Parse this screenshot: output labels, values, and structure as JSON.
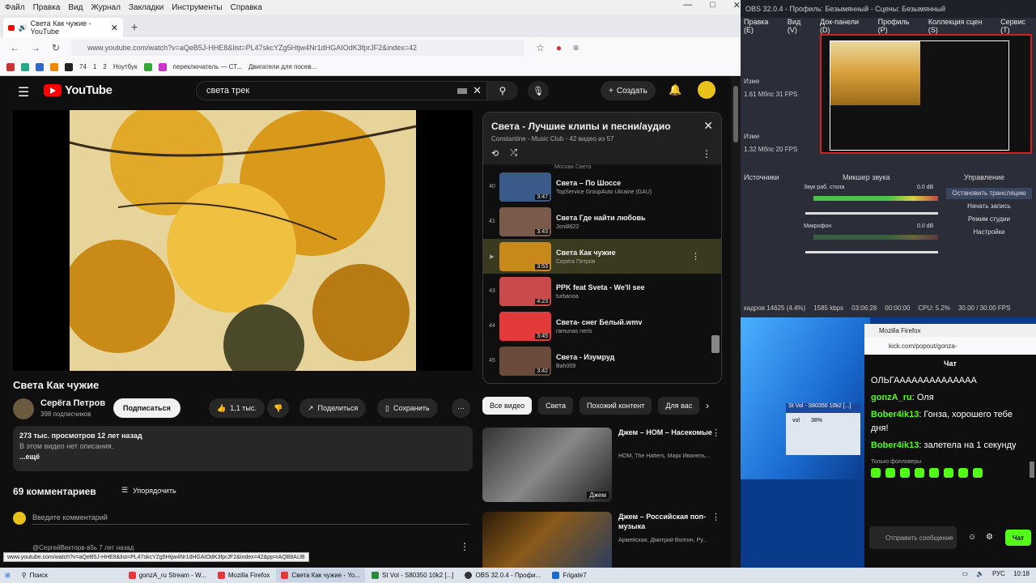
{
  "firefox": {
    "menu": [
      "Файл",
      "Правка",
      "Вид",
      "Журнал",
      "Закладки",
      "Инструменты",
      "Справка"
    ],
    "tab_title": "Света Как чужие - YouTube",
    "url": "www.youtube.com/watch?v=aQeB5J-HHE8&list=PL47skcYZg5Htjw4Nr1dHGAIOdK3fprJF2&index=42",
    "bookmarks": [
      "74",
      "1",
      "2",
      "Ноутбук",
      "переключатель — СТ...",
      "Двигатели для посев..."
    ],
    "status_url": "www.youtube.com/watch?v=aQeB5J-HHE8&list=PL47skcYZg5Htjw4Nr1dHGAIOdK3fprJF2&index=42&pp=iAQB8AUB"
  },
  "youtube": {
    "logo": "YouTube",
    "search_query": "света трек",
    "create_label": "Создать",
    "video": {
      "title": "Света Как чужие",
      "channel": "Серёга Петров",
      "subscribers": "398 подписчиков",
      "subscribe_label": "Подписаться",
      "likes": "1,1 тыс.",
      "share_label": "Поделиться",
      "save_label": "Сохранить",
      "views_date": "273 тыс. просмотров  12 лет назад",
      "no_description": "В этом видео нет описания.",
      "more_label": "...ещё"
    },
    "comments": {
      "count_label": "69 комментариев",
      "sort_label": "Упорядочить",
      "placeholder": "Введите комментарий",
      "first_author": "@СергейВекторв-в5ь 7 лет назад"
    },
    "playlist": {
      "title": "Света - Лучшие клипы и песни/аудио",
      "subtitle": "Constantine - Music Club - 42 видео из 57",
      "partial_label": "Москва Света",
      "items": [
        {
          "index": "40",
          "title": "Света – По Шоссе",
          "author": "TopService GroupAuto Ukraine (GAU)",
          "duration": "3:47",
          "color": "#3a5a8a"
        },
        {
          "index": "41",
          "title": "Света Где найти любовь",
          "author": "Joni8622",
          "duration": "3:43",
          "color": "#7a5a4a"
        },
        {
          "index": "",
          "title": "Света Как чужие",
          "author": "Серёга Петров",
          "duration": "3:53",
          "color": "#c8881a"
        },
        {
          "index": "43",
          "title": "PPK feat Sveta - We'll see",
          "author": "turbanoa",
          "duration": "4:23",
          "color": "#c84a4a"
        },
        {
          "index": "44",
          "title": "Света- снег Белый.wmv",
          "author": "ramunas neris",
          "duration": "3:45",
          "color": "#e23a3a"
        },
        {
          "index": "45",
          "title": "Света - Изумруд",
          "author": "Bah009",
          "duration": "3:42",
          "color": "#6a4a3a"
        }
      ]
    },
    "chips": [
      "Все видео",
      "Света",
      "Похожий контент",
      "Для вас"
    ],
    "recommendations": [
      {
        "title": "Джем – НОМ – Насекомые",
        "meta": "НОМ, The Hatters, Марк Иванель...",
        "badge": "Джем",
        "color": "#555"
      },
      {
        "title": "Джем – Российская поп-музыка",
        "meta": "Армейская, Дмитрий Волгин, Ру...",
        "badge": "",
        "color": "#6a4a2a"
      }
    ]
  },
  "obs": {
    "title": "OBS 32.0.4 - Профиль: Безымянный - Сцены: Безымянный",
    "menu": [
      "Правка (E)",
      "Вид (V)",
      "Док-панели (D)",
      "Профиль (P)",
      "Коллекция сцен (S)",
      "Сервис (T)"
    ],
    "stats": [
      "Изме",
      "1.61 Мбпс  31 FPS",
      "Изме",
      "1.32 Мбпс  20 FPS"
    ],
    "panel_headers": [
      "Источники",
      "Микшер звука",
      "Управление"
    ],
    "mixer_labels": [
      "Звук раб. стола",
      "Микрофон"
    ],
    "mixer_values": [
      "0.0 dB",
      "0.0 dB"
    ],
    "controls": [
      "Остановить трансляцию",
      "Начать запись",
      "Режим студии",
      "Настройки"
    ],
    "status": [
      "кадров 14625 (4.4%)",
      "1585 kbps",
      "03:06:28",
      "00:00:00",
      "CPU: 5.2%",
      "30.00 / 30.00 FPS"
    ]
  },
  "desktop": {
    "mini_window_title": "St Vol - S80350 10k2 [...]",
    "mini_window_values": [
      "vol",
      "38%"
    ]
  },
  "kick": {
    "window_title": "Mozilla Firefox",
    "url": "kick.com/popout/gonza-",
    "header": "Чат",
    "messages": [
      {
        "user": "",
        "text": "ОЛЬГАААААААААААААА"
      },
      {
        "user": "gonzA_ru",
        "text": ": Оля"
      },
      {
        "user": "Bober4ik13",
        "text": ": Гонза, хорошего тебе дня!"
      },
      {
        "user": "Bober4ik13",
        "text": ": залетела на 1 секунду"
      }
    ],
    "followers_only": "Только фолловеры",
    "input_placeholder": "Отправить сообщение",
    "chat_button": "Чат"
  },
  "taskbar": {
    "search": "Поиск",
    "items": [
      "gonzA_ru Stream - W...",
      "Mozilla Firefox",
      "Света Как чужие - Yo...",
      "St Vol - S80350 10k2 [...]",
      "OBS 32.0.4 - Профи...",
      "Frigate7"
    ],
    "lang": "РУС",
    "time": "10:18"
  },
  "colors": {
    "yt_bg": "#0f0f0f",
    "yt_red": "#ff0000",
    "kick_green": "#53fc18",
    "obs_bg": "#2b2e38"
  }
}
